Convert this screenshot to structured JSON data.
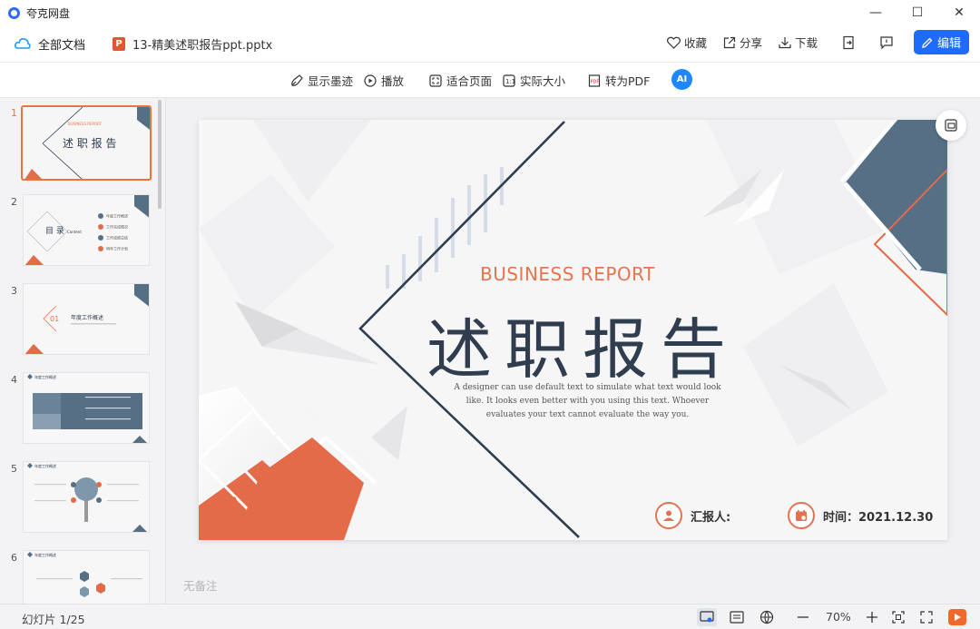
{
  "app": {
    "title": "夸克网盘",
    "min": "—",
    "max": "☐",
    "close": "✕"
  },
  "docbar": {
    "all_docs": "全部文档",
    "file_icon": "P",
    "filename": "13-精美述职报告ppt.pptx",
    "favorite": "收藏",
    "share": "分享",
    "download": "下载",
    "edit": "编辑"
  },
  "toolbar": {
    "show_ink": "显示墨迹",
    "play": "播放",
    "fit_page": "适合页面",
    "actual_size": "实际大小",
    "to_pdf": "转为PDF",
    "ai": "AI"
  },
  "thumbnails": [
    {
      "num": "1",
      "title": "述 职 报 告",
      "sub": "BUSINESS REPORT"
    },
    {
      "num": "2",
      "title": "目 录",
      "sub": "Content",
      "items": [
        "年度工作概述",
        "工作完成情况",
        "工作成绩总结",
        "明年工作计划"
      ]
    },
    {
      "num": "3",
      "title": "年度工作概述",
      "index": "01"
    },
    {
      "num": "4",
      "title": "年度工作概述"
    },
    {
      "num": "5",
      "title": "年度工作概述"
    },
    {
      "num": "6",
      "title": "年度工作概述"
    }
  ],
  "slide": {
    "subtitle": "BUSINESS  REPORT",
    "title": "述职报告",
    "body": "A designer can use default text to simulate what text would look like. It looks even better with you using this text. Whoever evaluates your text cannot evaluate the way you.",
    "reporter_label": "汇报人:",
    "date_label": "时间：2021.12.30"
  },
  "notes": "无备注",
  "status": {
    "page_info": "幻灯片 1/25",
    "zoom": "70%"
  },
  "colors": {
    "accent": "#1e6bff",
    "orange": "#e47550",
    "slate": "#566f84",
    "navy": "#2f3d4f"
  }
}
